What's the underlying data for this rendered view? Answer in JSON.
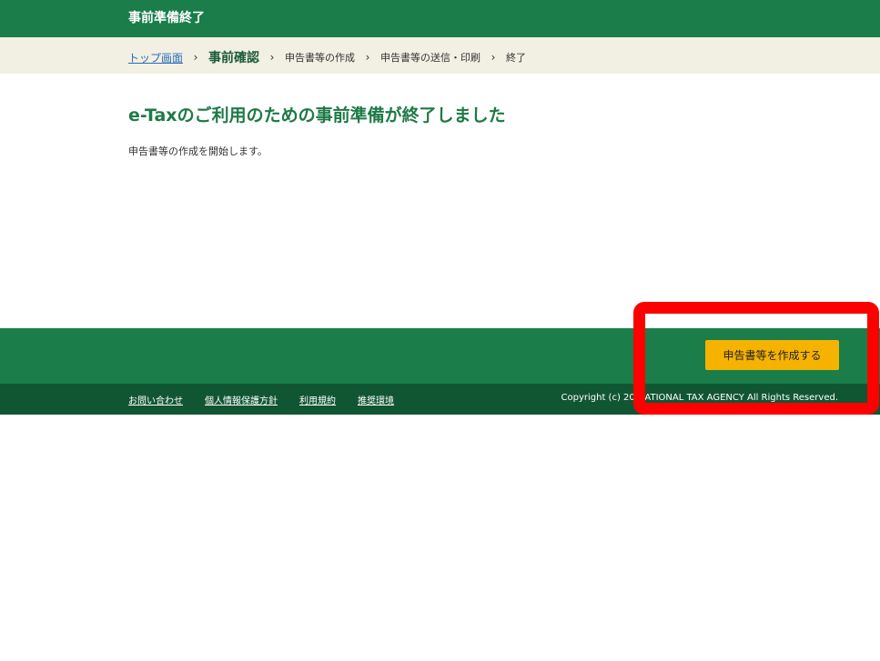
{
  "header": {
    "title": "事前準備終了"
  },
  "breadcrumb": {
    "items": [
      {
        "label": "トップ画面"
      },
      {
        "label": "事前確認"
      },
      {
        "label": "申告書等の作成"
      },
      {
        "label": "申告書等の送信・印刷"
      },
      {
        "label": "終了"
      }
    ],
    "separator": "›"
  },
  "main": {
    "title": "e-Taxのご利用のための事前準備が終了しました",
    "description": "申告書等の作成を開始します。"
  },
  "action": {
    "primary_label": "申告書等を作成する"
  },
  "footer": {
    "links": [
      {
        "label": "お問い合わせ"
      },
      {
        "label": "個人情報保護方針"
      },
      {
        "label": "利用規約"
      },
      {
        "label": "推奨環境"
      }
    ],
    "copyright": "Copyright (c) 20 NATIONAL TAX AGENCY All Rights Reserved."
  },
  "colors": {
    "header_green": "#1a7d4a",
    "footer_green": "#115633",
    "title_green": "#1e7a45",
    "button_yellow": "#f5b300",
    "highlight_red": "#ff0000"
  }
}
